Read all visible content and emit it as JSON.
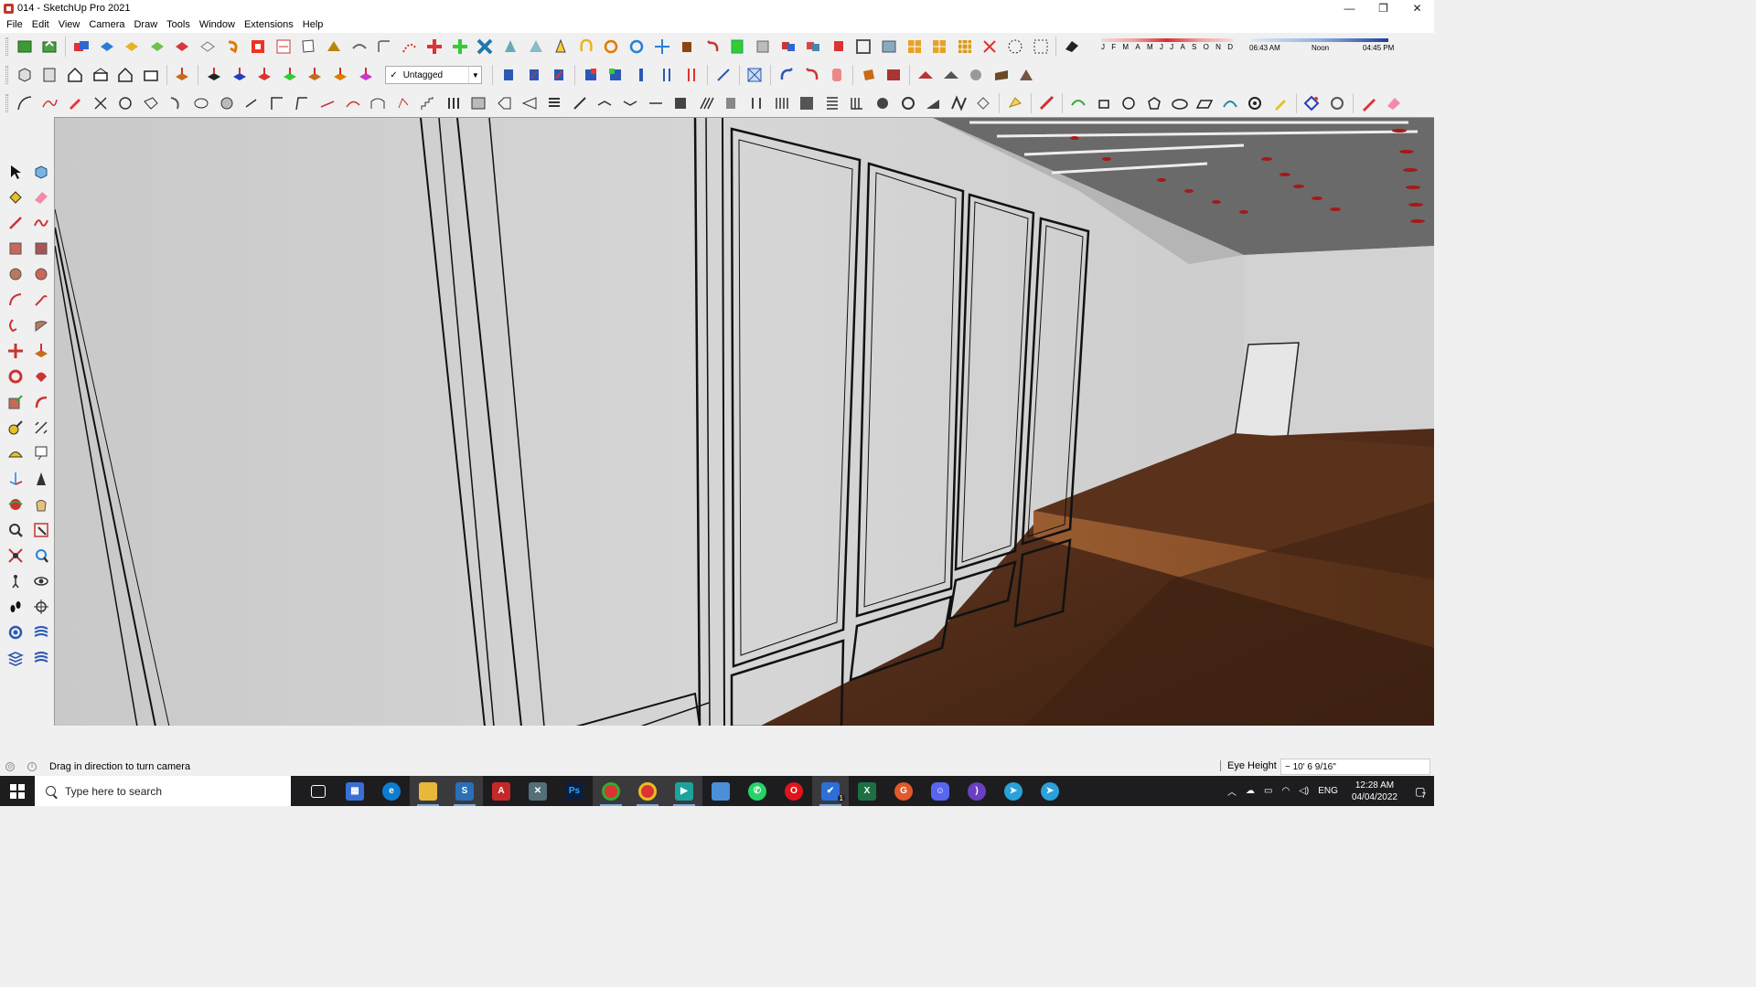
{
  "window": {
    "title": "014 - SketchUp Pro 2021",
    "controls": [
      "minimize",
      "restore",
      "close"
    ]
  },
  "menu": [
    "File",
    "Edit",
    "View",
    "Camera",
    "Draw",
    "Tools",
    "Window",
    "Extensions",
    "Help"
  ],
  "toolbar": {
    "tag_select_value": "Untagged",
    "shadow": {
      "months": [
        "J",
        "F",
        "M",
        "A",
        "M",
        "J",
        "J",
        "A",
        "S",
        "O",
        "N",
        "D"
      ],
      "time_start": "06:43 AM",
      "time_mid": "Noon",
      "time_end": "04:45 PM"
    }
  },
  "status": {
    "message": "Drag in direction to turn camera",
    "measurement_label": "Eye Height",
    "measurement_value": "~ 10' 6 9/16\""
  },
  "taskbar": {
    "search_placeholder": "Type here to search",
    "language": "ENG",
    "time": "12:28 AM",
    "date": "04/04/2022",
    "notification_count": "7",
    "badge_count": "1"
  },
  "colors": {
    "wall": "#cfcfcf",
    "floor_wood": "#5a3220",
    "ceiling": "#6e6e6e",
    "ceiling_lights": "#b21b1b"
  }
}
